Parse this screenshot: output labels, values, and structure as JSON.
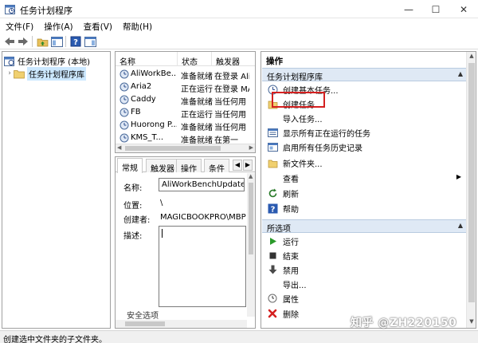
{
  "window": {
    "title": "任务计划程序",
    "minimize": "—",
    "maximize": "☐",
    "close": "✕"
  },
  "menu": [
    "文件(F)",
    "操作(A)",
    "查看(V)",
    "帮助(H)"
  ],
  "tree": {
    "root": "任务计划程序 (本地)",
    "child": "任务计划程序库"
  },
  "task_list": {
    "columns": [
      "名称",
      "状态",
      "触发器"
    ],
    "rows": [
      {
        "name": "AliWorkBe...",
        "status": "准备就绪",
        "trigger": "在登录 AliW"
      },
      {
        "name": "Aria2",
        "status": "正在运行",
        "trigger": "在登录 MA"
      },
      {
        "name": "Caddy",
        "status": "准备就绪",
        "trigger": "当任何用"
      },
      {
        "name": "FB",
        "status": "正在运行",
        "trigger": "当任何用"
      },
      {
        "name": "Huorong P...",
        "status": "准备就绪",
        "trigger": "当任何用"
      },
      {
        "name": "KMS_T...",
        "status": "准备就绪",
        "trigger": "在第一"
      }
    ]
  },
  "detail": {
    "tabs": [
      "常规",
      "触发器",
      "操作",
      "条件"
    ],
    "name_label": "名称:",
    "name_value": "AliWorkBenchUpdater",
    "location_label": "位置:",
    "location_value": "\\",
    "author_label": "创建者:",
    "author_value": "MAGICBOOKPRO\\MBP",
    "desc_label": "描述:",
    "security_label": "安全选项"
  },
  "actions": {
    "title": "操作",
    "section1": "任务计划程序库",
    "items1": [
      {
        "label": "创建基本任务...",
        "icon": "create-basic-task-icon",
        "submenu": false
      },
      {
        "label": "创建任务...",
        "icon": "create-task-icon",
        "submenu": false
      },
      {
        "label": "导入任务...",
        "icon": "import-task-icon",
        "submenu": false
      },
      {
        "label": "显示所有正在运行的任务",
        "icon": "running-tasks-icon",
        "submenu": false
      },
      {
        "label": "启用所有任务历史记录",
        "icon": "history-icon",
        "submenu": false
      },
      {
        "label": "新文件夹...",
        "icon": "new-folder-icon",
        "submenu": false
      },
      {
        "label": "查看",
        "icon": "view-icon",
        "submenu": true
      },
      {
        "label": "刷新",
        "icon": "refresh-icon",
        "submenu": false
      },
      {
        "label": "帮助",
        "icon": "help-icon",
        "submenu": false
      }
    ],
    "section2": "所选项",
    "items2": [
      {
        "label": "运行",
        "icon": "run-icon"
      },
      {
        "label": "结束",
        "icon": "end-icon"
      },
      {
        "label": "禁用",
        "icon": "disable-icon"
      },
      {
        "label": "导出...",
        "icon": "export-icon"
      },
      {
        "label": "属性",
        "icon": "properties-icon"
      },
      {
        "label": "删除",
        "icon": "delete-icon"
      }
    ]
  },
  "status_bar": "创建选中文件夹的子文件夹。",
  "watermark": "知乎 @ZH220150",
  "colors": {
    "selection": "#cce8ff",
    "section_header": "#dfe9f5",
    "highlight": "#d42020"
  }
}
